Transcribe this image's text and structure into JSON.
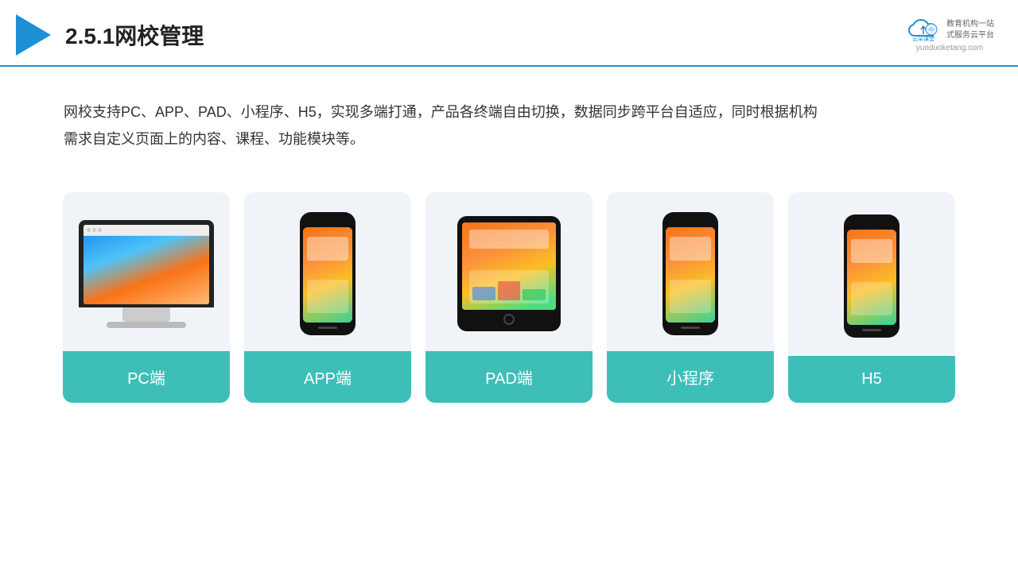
{
  "header": {
    "title": "2.5.1网校管理",
    "brand": {
      "name": "云朵课堂",
      "url": "yunduoketang.com",
      "tagline": "教育机构一站\n式服务云平台"
    }
  },
  "description": {
    "text": "网校支持PC、APP、PAD、小程序、H5，实现多端打通，产品各终端自由切换，数据同步跨平台自适应，同时根据机构需求自定义页面上的内容、课程、功能模块等。"
  },
  "cards": [
    {
      "id": "pc",
      "label": "PC端"
    },
    {
      "id": "app",
      "label": "APP端"
    },
    {
      "id": "pad",
      "label": "PAD端"
    },
    {
      "id": "mp",
      "label": "小程序"
    },
    {
      "id": "h5",
      "label": "H5"
    }
  ],
  "colors": {
    "accent": "#1e90d4",
    "teal": "#3dbfb8",
    "bg_card": "#eef2f7"
  }
}
